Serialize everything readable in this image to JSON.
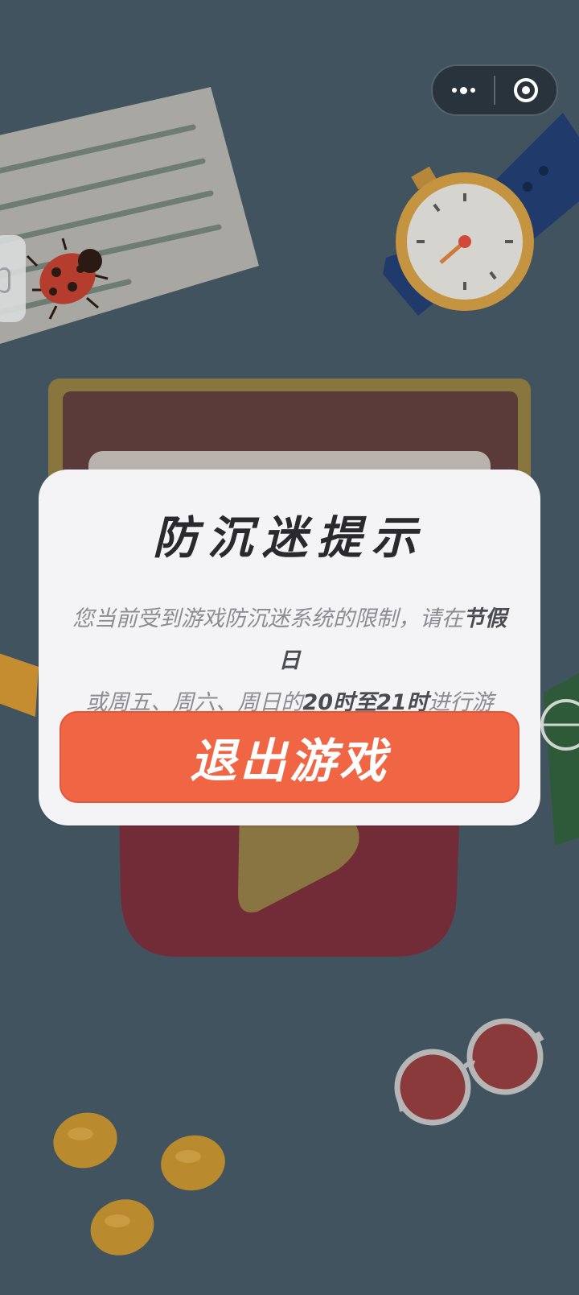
{
  "capsule": {
    "menu_icon": "more-dots-icon",
    "close_icon": "target-close-icon"
  },
  "dialog": {
    "title": "防沉迷提示",
    "message_normal": "您当前受到游戏防沉迷系统的限制，请在",
    "message_emph_1": "节假日",
    "message_normal_2": "或周五、周六、周日的",
    "message_emph_2": "20时至21时",
    "message_normal_3": "进行游玩。",
    "exit_label": "退出游戏"
  },
  "colors": {
    "background": "#41535f",
    "dialog": "#f4f4f6",
    "exit_button": "#f06644",
    "title": "#2a2a2e",
    "message": "#8c8c92"
  }
}
